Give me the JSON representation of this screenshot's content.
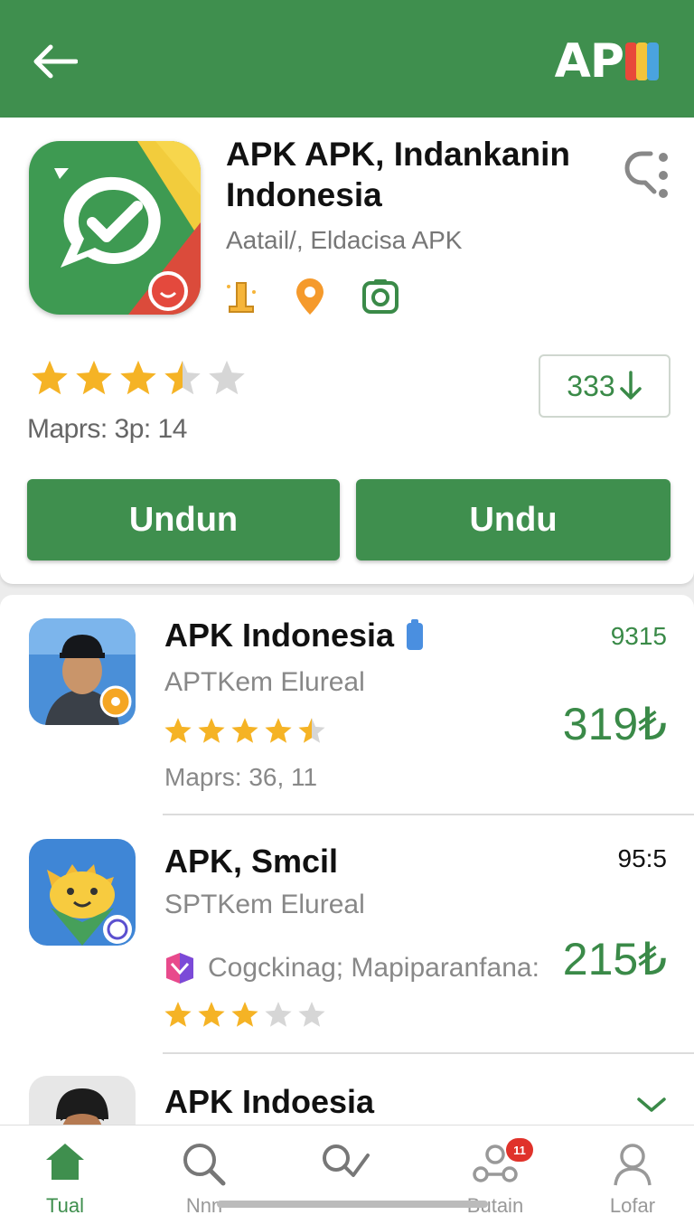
{
  "header": {
    "logo_text": "AP",
    "colors": {
      "primary": "#3f8f4e",
      "accent_green": "#3a8a48",
      "star": "#f5b325",
      "badge": "#e0322a"
    }
  },
  "app": {
    "title": "APK APK, Indankanin Indonesia",
    "subtitle": "Aatail/, Eldacisa APK",
    "meta_icons": [
      "award-icon",
      "location-pin-icon",
      "camera-icon"
    ],
    "rating": 3.5,
    "reviews": "Maprs: 3p: 14",
    "downloads": "333",
    "button_primary": "Undun",
    "button_secondary": "Undu"
  },
  "list": [
    {
      "name": "APK Indonesia",
      "developer": "APTKem Elureal",
      "rating": 4.5,
      "reviews": "Maprs: 36, 11",
      "count": "9315",
      "price": "319₺"
    },
    {
      "name": "APK, Smcil",
      "developer": "SPTKem Elureal",
      "category": "Cogckinag; Mapiparanfana:",
      "rating": 3,
      "count": "95:5",
      "price": "215₺"
    },
    {
      "name": "APK Indoesia"
    }
  ],
  "bottom_nav": [
    {
      "label": "Tual",
      "icon": "home-icon",
      "active": true
    },
    {
      "label": "Nnn",
      "icon": "search-icon"
    },
    {
      "label": "",
      "icon": "check-search-icon"
    },
    {
      "label": "Butain",
      "icon": "people-icon",
      "badge": "11"
    },
    {
      "label": "Lofar",
      "icon": "profile-icon"
    }
  ]
}
